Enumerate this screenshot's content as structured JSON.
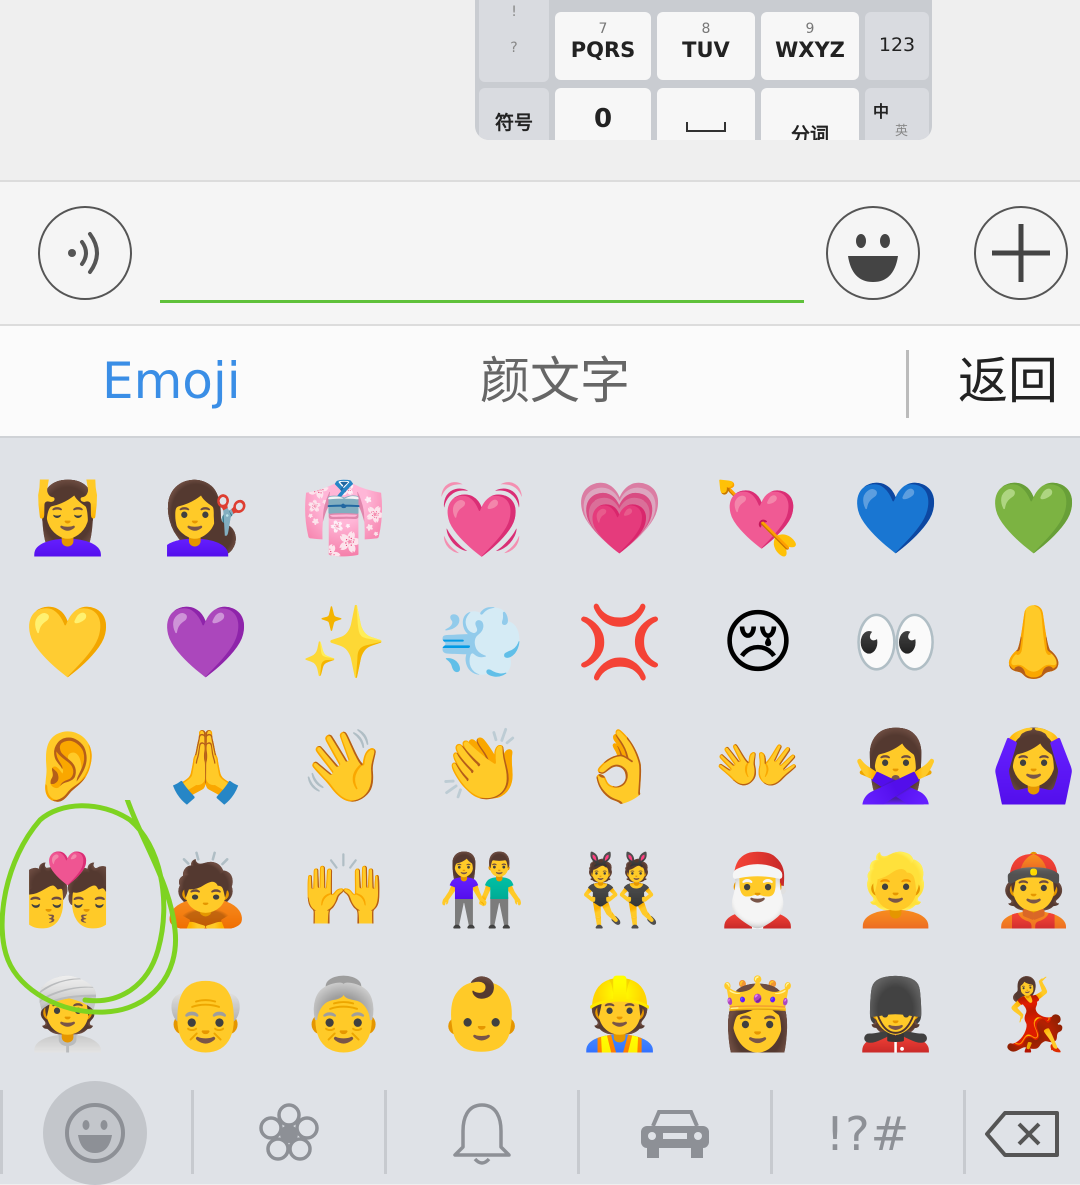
{
  "mini_keypad": {
    "keys": [
      {
        "num": "7",
        "letters": "PQRS"
      },
      {
        "num": "8",
        "letters": "TUV"
      },
      {
        "num": "9",
        "letters": "WXYZ"
      },
      {
        "num": "",
        "letters": "0"
      },
      {
        "num": "",
        "letters": "分词"
      }
    ],
    "side_left_top": "!",
    "side_left_mid": "?",
    "symbol_key": "符号",
    "num_key": "123",
    "lang_key": "中",
    "lang_key_sub": "英"
  },
  "input_bar": {
    "text_value": "",
    "voice_icon": "voice-wave-icon",
    "emoji_icon": "smiley-icon",
    "plus_icon": "plus-icon"
  },
  "tabs": {
    "emoji": "Emoji",
    "kaomoji": "颜文字",
    "back": "返回"
  },
  "emoji_grid": [
    "💆‍♀️",
    "💇‍♀️",
    "👘",
    "💓",
    "💗",
    "💘",
    "💙",
    "💚",
    "💛",
    "💜",
    "✨",
    "💨",
    "💢",
    "😢",
    "👀",
    "👃",
    "👂",
    "🙏",
    "👋",
    "👏",
    "👌",
    "👐",
    "🙅‍♀️",
    "🙆‍♀️",
    "💏",
    "🙇",
    "🙌",
    "👫",
    "👯",
    "🎅",
    "👱",
    "👲",
    "👳",
    "👴",
    "👵",
    "👶",
    "👷",
    "👸",
    "💂",
    "💃"
  ],
  "categories": [
    {
      "name": "smileys",
      "icon": "smiley-icon",
      "selected": true
    },
    {
      "name": "nature",
      "icon": "flower-icon",
      "selected": false
    },
    {
      "name": "objects",
      "icon": "bell-icon",
      "selected": false
    },
    {
      "name": "travel",
      "icon": "car-icon",
      "selected": false
    },
    {
      "name": "symbols",
      "label": "!?#",
      "selected": false
    },
    {
      "name": "delete",
      "icon": "backspace-icon",
      "selected": false
    }
  ],
  "colors": {
    "accent_tab": "#3a8ee6",
    "input_underline": "#5fc13a",
    "annotation": "#7ed321"
  }
}
